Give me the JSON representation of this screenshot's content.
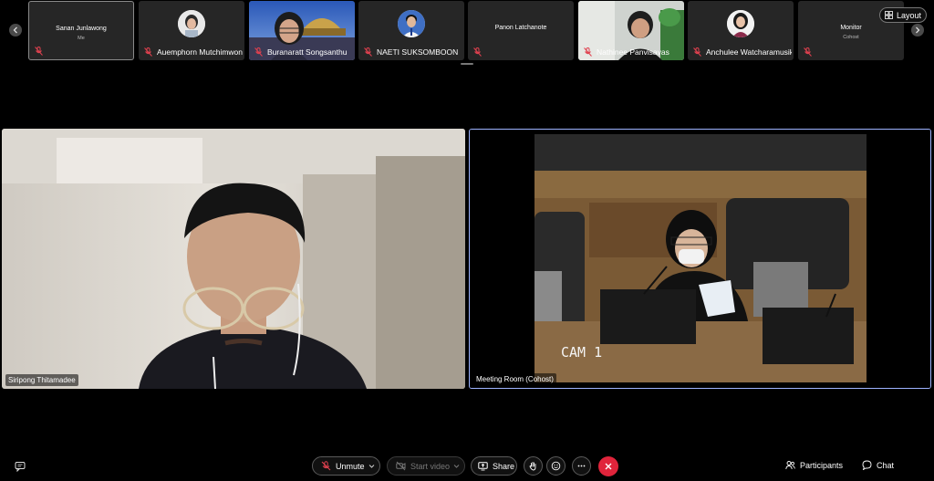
{
  "filmstrip": {
    "tiles": [
      {
        "name": "Sanan Junlawong",
        "sub": "Me",
        "muted": true
      },
      {
        "name": "Auemphorn Mutchimwong",
        "muted": true
      },
      {
        "name": "Buranaratt Songsanthu",
        "muted": true
      },
      {
        "name": "NAETI SUKSOMBOON",
        "muted": true
      },
      {
        "name": "Panon Latchanote",
        "muted": true
      },
      {
        "name": "Nathinee Panvisavas",
        "muted": true
      },
      {
        "name": "Anchulee Watcharamusik",
        "muted": true
      },
      {
        "name": "Monitor",
        "sub": "Cohost",
        "muted": true
      }
    ],
    "layout_label": "Layout"
  },
  "main": {
    "left_label": "Siripong Thitamadee",
    "right_label": "Meeting Room (Cohost)",
    "cam_overlay": "CAM 1"
  },
  "toolbar": {
    "unmute_label": "Unmute",
    "start_video_label": "Start video",
    "share_label": "Share",
    "participants_label": "Participants",
    "chat_label": "Chat"
  },
  "colors": {
    "end_call": "#e0243b",
    "active_border": "#9db3ff",
    "muted_icon": "#e0414f"
  }
}
